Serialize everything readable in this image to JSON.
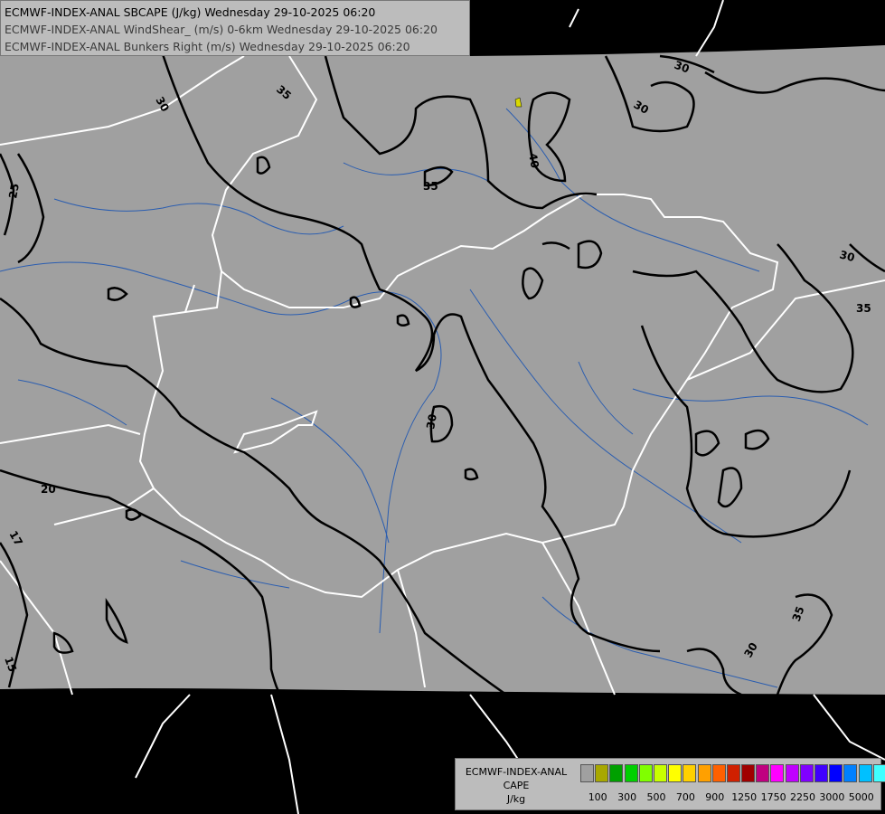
{
  "header": {
    "line1": "ECMWF-INDEX-ANAL SBCAPE (J/kg) Wednesday 29-10-2025 06:20",
    "line2": "ECMWF-INDEX-ANAL WindShear_ (m/s) 0-6km Wednesday 29-10-2025 06:20",
    "line3": "ECMWF-INDEX-ANAL Bunkers Right (m/s) Wednesday 29-10-2025 06:20"
  },
  "legend": {
    "model": "ECMWF-INDEX-ANAL",
    "field": "CAPE",
    "unit": "J/kg",
    "colors": [
      "#a0a0a0",
      "#a8a800",
      "#00a000",
      "#00d000",
      "#80ff00",
      "#c8ff00",
      "#ffff00",
      "#ffd000",
      "#ffa000",
      "#ff6000",
      "#d02000",
      "#a00000",
      "#c00080",
      "#ff00ff",
      "#c000ff",
      "#8000ff",
      "#4000ff",
      "#0000ff",
      "#0080ff",
      "#00c0ff",
      "#40ffff",
      "#ffffff"
    ],
    "tick_labels": [
      "100",
      "300",
      "500",
      "700",
      "900",
      "1250",
      "1750",
      "2250",
      "3000",
      "5000"
    ]
  },
  "contour_labels": [
    "30",
    "35",
    "40",
    "35",
    "30",
    "25",
    "30",
    "30",
    "35",
    "30",
    "20",
    "17",
    "15",
    "35",
    "30"
  ],
  "colors": {
    "background": "#000000",
    "land": "#a0a0a0",
    "borders": "#ffffff",
    "rivers": "#2a5db0",
    "contours": "#000000",
    "cape_low": "#d8d800"
  }
}
